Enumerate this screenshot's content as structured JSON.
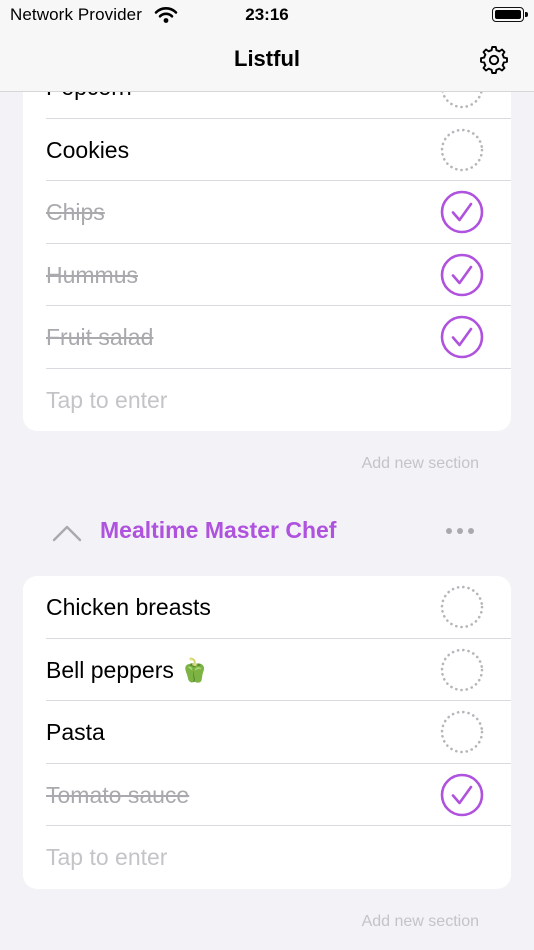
{
  "status_bar": {
    "carrier": "Network Provider",
    "time": "23:16"
  },
  "nav": {
    "title": "Listful",
    "settings_icon": "gear-icon"
  },
  "colors": {
    "accent": "#af52de",
    "done_text": "#a9a9ae",
    "placeholder": "#c4c4c8",
    "background": "#f2f2f7"
  },
  "section1": {
    "items": [
      {
        "label": "Popcorn",
        "done": false
      },
      {
        "label": "Cookies",
        "done": false
      },
      {
        "label": "Chips",
        "done": true
      },
      {
        "label": "Hummus",
        "done": true
      },
      {
        "label": "Fruit salad",
        "done": true
      }
    ],
    "entry_placeholder": "Tap to enter",
    "add_section_label": "Add new section"
  },
  "section2": {
    "title": "Mealtime Master Chef",
    "collapse_icon": "chevron-up-icon",
    "more_icon": "ellipsis-icon",
    "items": [
      {
        "label": "Chicken breasts",
        "done": false
      },
      {
        "label": "Bell peppers 🫑",
        "done": false
      },
      {
        "label": "Pasta",
        "done": false
      },
      {
        "label": "Tomato sauce",
        "done": true
      }
    ],
    "entry_placeholder": "Tap to enter",
    "add_section_label": "Add new section"
  }
}
